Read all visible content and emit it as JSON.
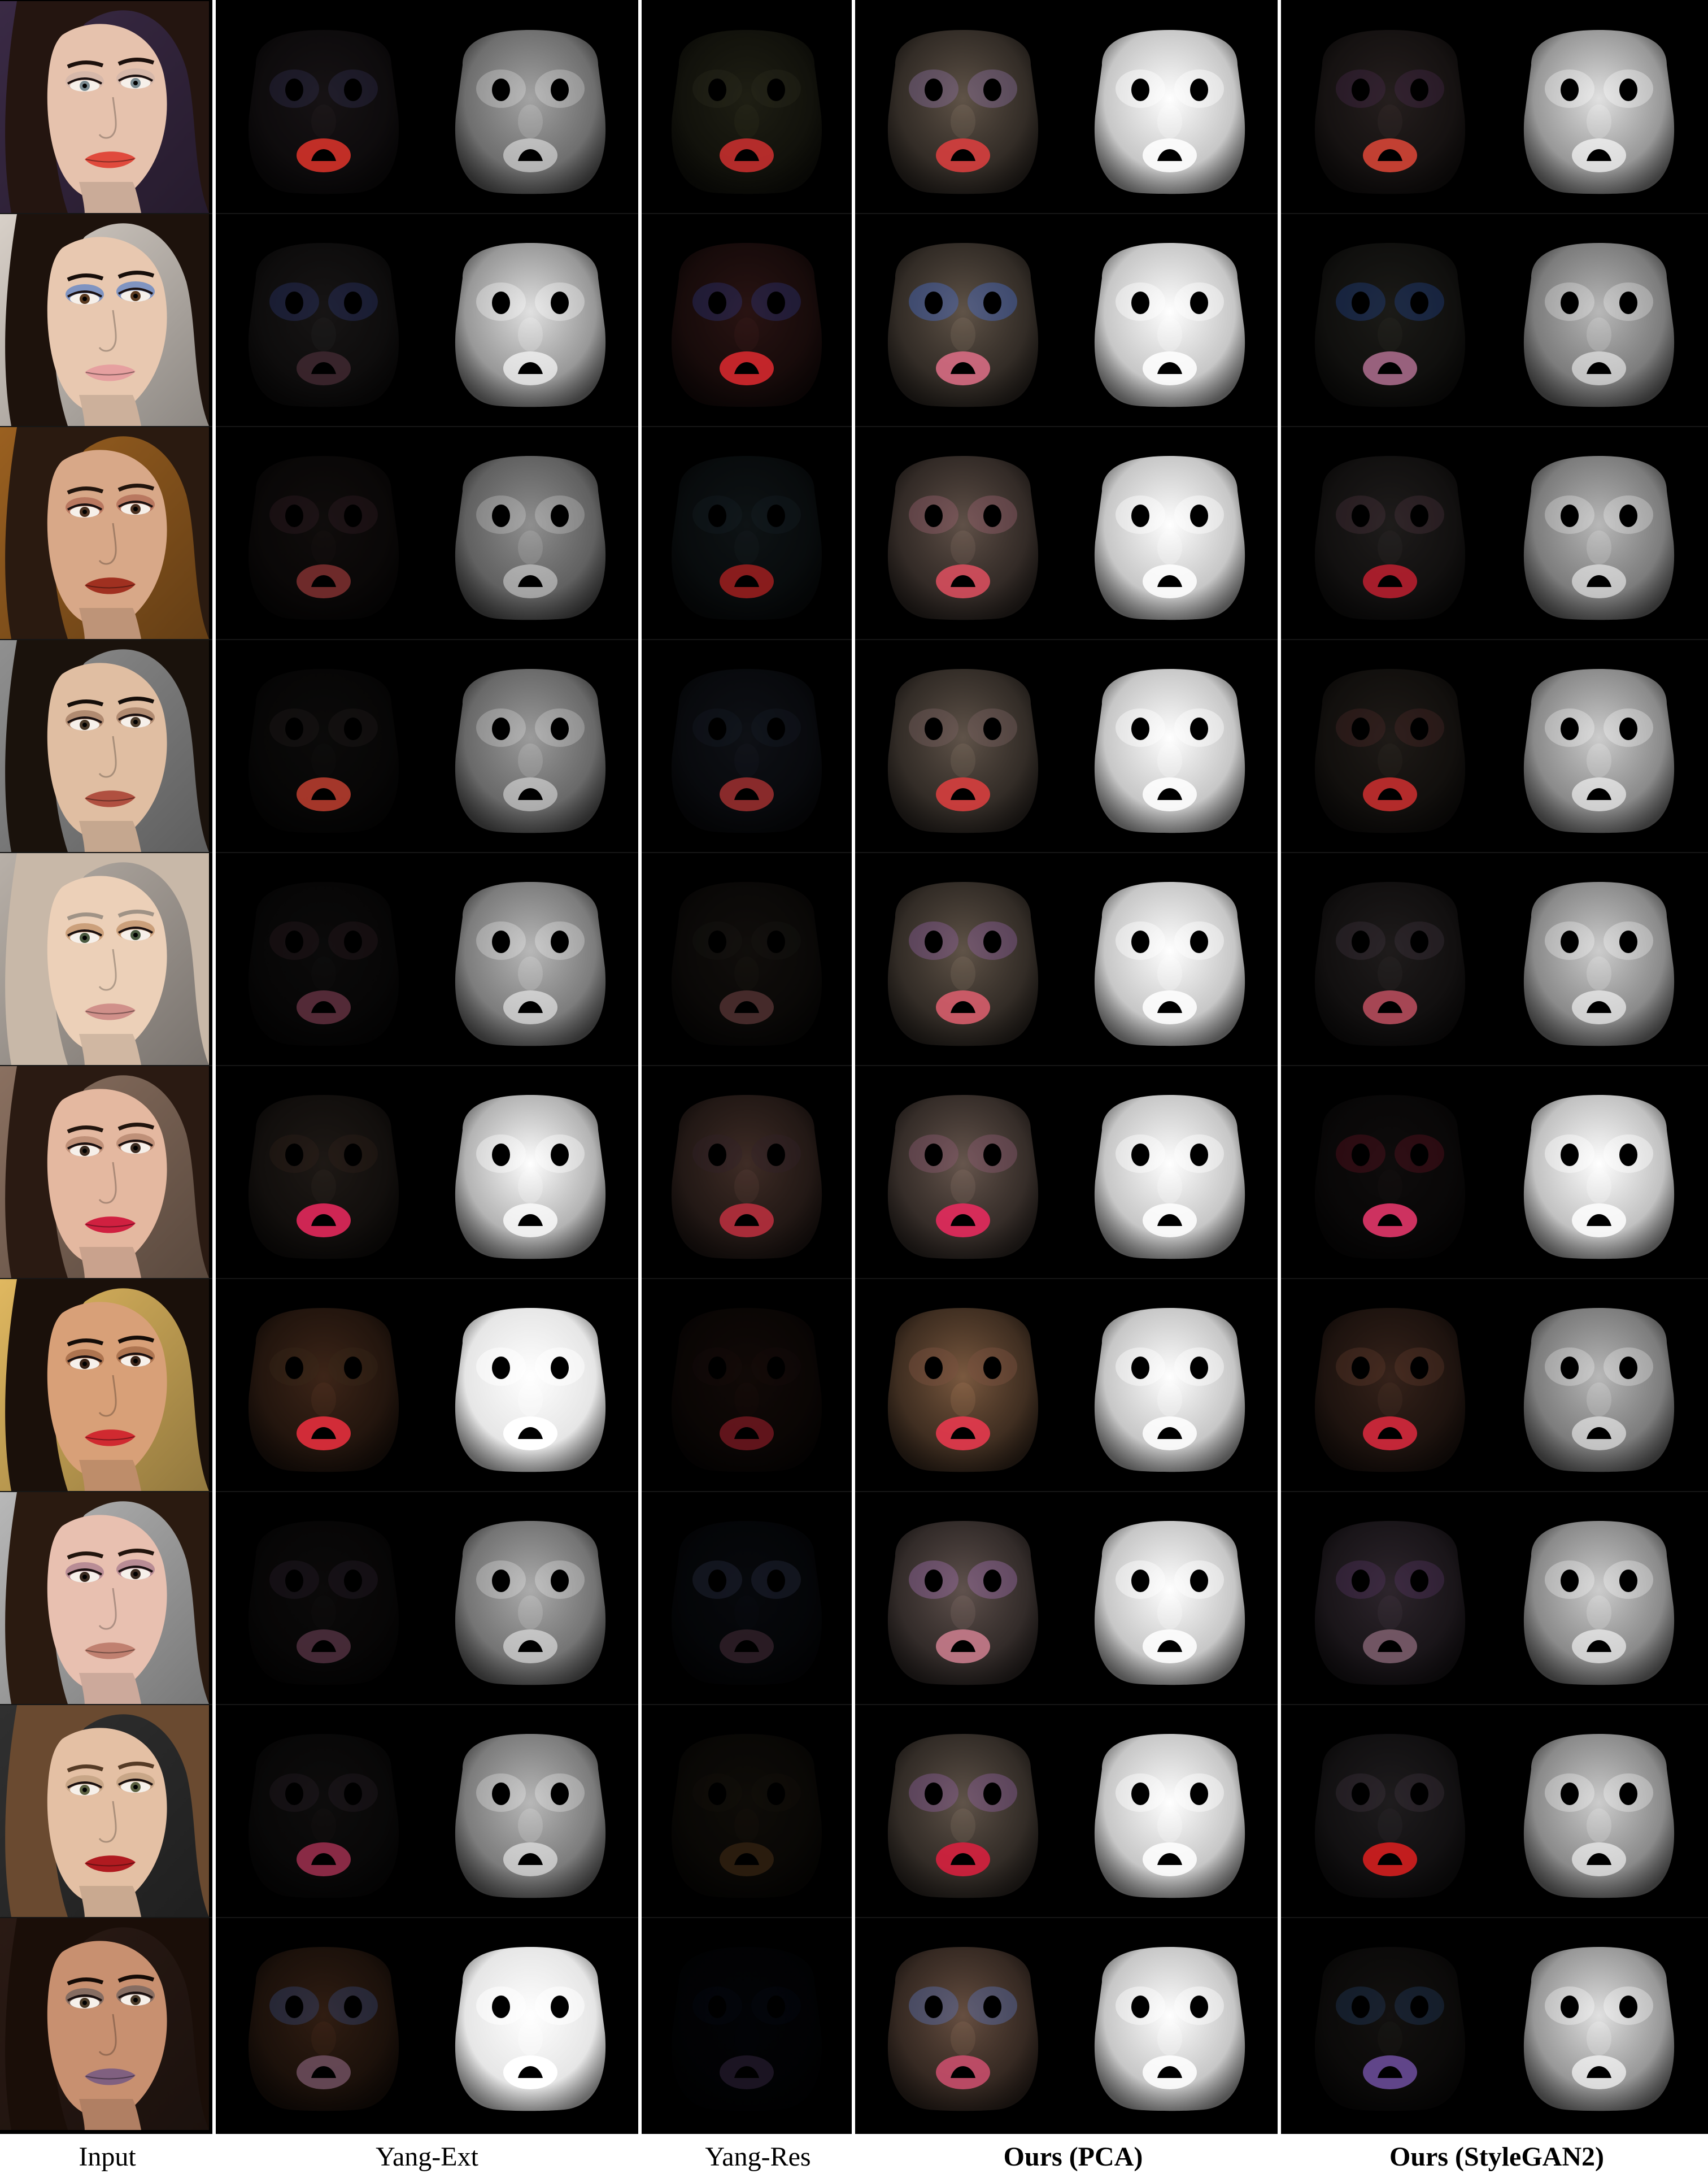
{
  "columns": [
    {
      "label": "Input",
      "bold": false
    },
    {
      "label": "Yang-Ext",
      "bold": false
    },
    {
      "label": "Yang-Res",
      "bold": false
    },
    {
      "label": "Ours (PCA)",
      "bold": true
    },
    {
      "label": "Ours (StyleGAN2)",
      "bold": true
    }
  ],
  "rows": [
    {
      "skin": "#e6c2ad",
      "hair": "#241510",
      "bg": "#3a2a45",
      "eye": "#7a8a90",
      "lip": "#e04a3c",
      "shadow": "#c8b0a8",
      "ext": {
        "b": 0.14,
        "tint": "#5a4a52",
        "lip": "#e0352c",
        "spec": 0.4,
        "eyeTint": "#5a5aa0"
      },
      "res": {
        "b": 0.22,
        "tint": "#4a4a30",
        "lip": "#d03030",
        "eyeTint": "#303020"
      },
      "pca": {
        "b": 0.34,
        "tint": "#8a7868",
        "lip": "#e04040",
        "eyeTint": "#8a70a0"
      },
      "gan": {
        "b": 0.22,
        "tint": "#5a4a48",
        "lip": "#e04838",
        "eyeTint": "#5a3060",
        "spec": 0.55
      }
    },
    {
      "skin": "#e8c8b0",
      "hair": "#1d120c",
      "bg": "#d8d0c8",
      "eye": "#5a3a20",
      "lip": "#e6a0a0",
      "shadow": "#2a6ad0",
      "ext": {
        "b": 0.16,
        "tint": "#504848",
        "lip": "#402830",
        "spec": 0.55,
        "eyeTint": "#4a60d0"
      },
      "res": {
        "b": 0.24,
        "tint": "#5a2a28",
        "lip": "#e02a30",
        "eyeTint": "#3040a0"
      },
      "pca": {
        "b": 0.34,
        "tint": "#8a7868",
        "lip": "#e07088",
        "eyeTint": "#4a70d0"
      },
      "gan": {
        "b": 0.2,
        "tint": "#4a4840",
        "lip": "#b07090",
        "eyeTint": "#2a60d0",
        "spec": 0.45
      }
    },
    {
      "skin": "#d8a888",
      "hair": "#2a1a10",
      "bg": "#9a6020",
      "eye": "#4a3020",
      "lip": "#a03020",
      "shadow": "#a05040",
      "ext": {
        "b": 0.12,
        "tint": "#4a3a38",
        "lip": "#803030",
        "spec": 0.35,
        "eyeTint": "#704050"
      },
      "res": {
        "b": 0.18,
        "tint": "#2a3a40",
        "lip": "#a02020",
        "eyeTint": "#1a2a30"
      },
      "pca": {
        "b": 0.34,
        "tint": "#8a7468",
        "lip": "#e05060",
        "eyeTint": "#9a6070"
      },
      "gan": {
        "b": 0.22,
        "tint": "#4a4442",
        "lip": "#c02030",
        "eyeTint": "#604050",
        "spec": 0.45
      }
    },
    {
      "skin": "#e0bea2",
      "hair": "#1a120c",
      "bg": "#909090",
      "eye": "#4a3a2a",
      "lip": "#b05040",
      "shadow": "#8a6048",
      "ext": {
        "b": 0.1,
        "tint": "#403a38",
        "lip": "#c04030",
        "spec": 0.38,
        "eyeTint": "#504040"
      },
      "res": {
        "b": 0.16,
        "tint": "#30384a",
        "lip": "#a03030",
        "eyeTint": "#202838"
      },
      "pca": {
        "b": 0.34,
        "tint": "#8a786a",
        "lip": "#e04040",
        "eyeTint": "#7a6060"
      },
      "gan": {
        "b": 0.22,
        "tint": "#4a4038",
        "lip": "#d03030",
        "eyeTint": "#603030",
        "spec": 0.5
      }
    },
    {
      "skin": "#ecd0b8",
      "hair": "#c8b8a8",
      "bg": "#b8b0a8",
      "eye": "#4a5a40",
      "lip": "#d0908a",
      "shadow": "#b07848",
      "ext": {
        "b": 0.1,
        "tint": "#403a3a",
        "lip": "#603040",
        "spec": 0.45,
        "eyeTint": "#704050"
      },
      "res": {
        "b": 0.16,
        "tint": "#3a3028",
        "lip": "#503030",
        "eyeTint": "#202018"
      },
      "pca": {
        "b": 0.34,
        "tint": "#8a7868",
        "lip": "#e06070",
        "eyeTint": "#9060a0"
      },
      "gan": {
        "b": 0.22,
        "tint": "#4a4242",
        "lip": "#c05060",
        "eyeTint": "#504050",
        "spec": 0.5
      }
    },
    {
      "skin": "#e4b8a0",
      "hair": "#2a1a12",
      "bg": "#8a7060",
      "eye": "#3a2a20",
      "lip": "#d02040",
      "shadow": "#a07058",
      "ext": {
        "b": 0.18,
        "tint": "#5a4a40",
        "lip": "#f02a60",
        "spec": 0.65,
        "eyeTint": "#402820"
      },
      "res": {
        "b": 0.3,
        "tint": "#6a4a40",
        "lip": "#c03040",
        "eyeTint": "#302028"
      },
      "pca": {
        "b": 0.36,
        "tint": "#8a7468",
        "lip": "#f02a60",
        "eyeTint": "#8a5a70"
      },
      "gan": {
        "b": 0.14,
        "tint": "#3a3030",
        "lip": "#f03a70",
        "eyeTint": "#d02040",
        "spec": 0.7
      }
    },
    {
      "skin": "#d8a078",
      "hair": "#1a100a",
      "bg": "#e0b860",
      "eye": "#3a2418",
      "lip": "#d02a30",
      "shadow": "#8a5030",
      "ext": {
        "b": 0.26,
        "tint": "#7a4a30",
        "lip": "#f03040",
        "spec": 0.85,
        "eyeTint": "#3a2818"
      },
      "res": {
        "b": 0.16,
        "tint": "#3a2018",
        "lip": "#701820",
        "eyeTint": "#201010"
      },
      "pca": {
        "b": 0.38,
        "tint": "#9a7050",
        "lip": "#f03a50",
        "eyeTint": "#7a5040"
      },
      "gan": {
        "b": 0.26,
        "tint": "#6a4434",
        "lip": "#e02a40",
        "eyeTint": "#6a4030",
        "spec": 0.45
      }
    },
    {
      "skin": "#e8c0b0",
      "hair": "#2a1a10",
      "bg": "#b8b8b8",
      "eye": "#3a2a20",
      "lip": "#c08070",
      "shadow": "#906080",
      "ext": {
        "b": 0.1,
        "tint": "#403838",
        "lip": "#503040",
        "spec": 0.42,
        "eyeTint": "#6a4870"
      },
      "res": {
        "b": 0.12,
        "tint": "#20283a",
        "lip": "#302028",
        "eyeTint": "#6070a0"
      },
      "pca": {
        "b": 0.34,
        "tint": "#8a7670",
        "lip": "#d08090",
        "eyeTint": "#a070b0"
      },
      "gan": {
        "b": 0.26,
        "tint": "#5a4a58",
        "lip": "#806070",
        "eyeTint": "#603870",
        "spec": 0.5
      }
    },
    {
      "skin": "#e4c0a4",
      "hair": "#6a4a30",
      "bg": "#303030",
      "eye": "#5a6040",
      "lip": "#b01a20",
      "shadow": "#b09070",
      "ext": {
        "b": 0.12,
        "tint": "#403a3a",
        "lip": "#a03050",
        "spec": 0.45,
        "eyeTint": "#504050"
      },
      "res": {
        "b": 0.14,
        "tint": "#3a3020",
        "lip": "#302010",
        "eyeTint": "#201810"
      },
      "pca": {
        "b": 0.34,
        "tint": "#8a786a",
        "lip": "#e02040",
        "eyeTint": "#9060a0"
      },
      "gan": {
        "b": 0.22,
        "tint": "#4a4448",
        "lip": "#e02020",
        "eyeTint": "#504050",
        "spec": 0.5
      }
    },
    {
      "skin": "#c89070",
      "hair": "#1a0e08",
      "bg": "#2a1a14",
      "eye": "#4a3a28",
      "lip": "#806080",
      "shadow": "#505058",
      "ext": {
        "b": 0.24,
        "tint": "#6a4028",
        "lip": "#705060",
        "spec": 0.9,
        "eyeTint": "#3a58a0"
      },
      "res": {
        "b": 0.08,
        "tint": "#10182a",
        "lip": "#201828",
        "eyeTint": "#102040"
      },
      "pca": {
        "b": 0.36,
        "tint": "#8a6a58",
        "lip": "#d05070",
        "eyeTint": "#5a70b0"
      },
      "gan": {
        "b": 0.18,
        "tint": "#3a3430",
        "lip": "#7050a0",
        "eyeTint": "#3060a0",
        "spec": 0.55
      }
    }
  ]
}
